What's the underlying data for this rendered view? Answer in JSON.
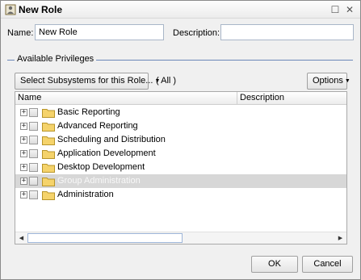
{
  "window": {
    "title": "New Role",
    "maximize_glyph": "☐",
    "close_glyph": "✕",
    "icon": "role-icon"
  },
  "form": {
    "name_label": "Name:",
    "name_value": "New Role",
    "description_label": "Description:",
    "description_value": ""
  },
  "privileges": {
    "section_label": "Available Privileges",
    "subsystems_button": "Select Subsystems for this Role...",
    "subsystems_scope": "( All )",
    "options_button": "Options"
  },
  "tree": {
    "columns": {
      "name": "Name",
      "description": "Description"
    },
    "expand_glyph": "+",
    "rows": [
      {
        "label": "Basic Reporting"
      },
      {
        "label": "Advanced Reporting"
      },
      {
        "label": "Scheduling and Distribution"
      },
      {
        "label": "Application Development"
      },
      {
        "label": "Desktop Development"
      },
      {
        "label": "Group Administration"
      },
      {
        "label": "Administration"
      }
    ],
    "selected_row": "Group Administration"
  },
  "footer": {
    "ok_label": "OK",
    "cancel_label": "Cancel"
  },
  "colors": {
    "accent_line": "#6b87b8",
    "folder": "#f5d36b",
    "selected_row": "#d7d7d7"
  }
}
